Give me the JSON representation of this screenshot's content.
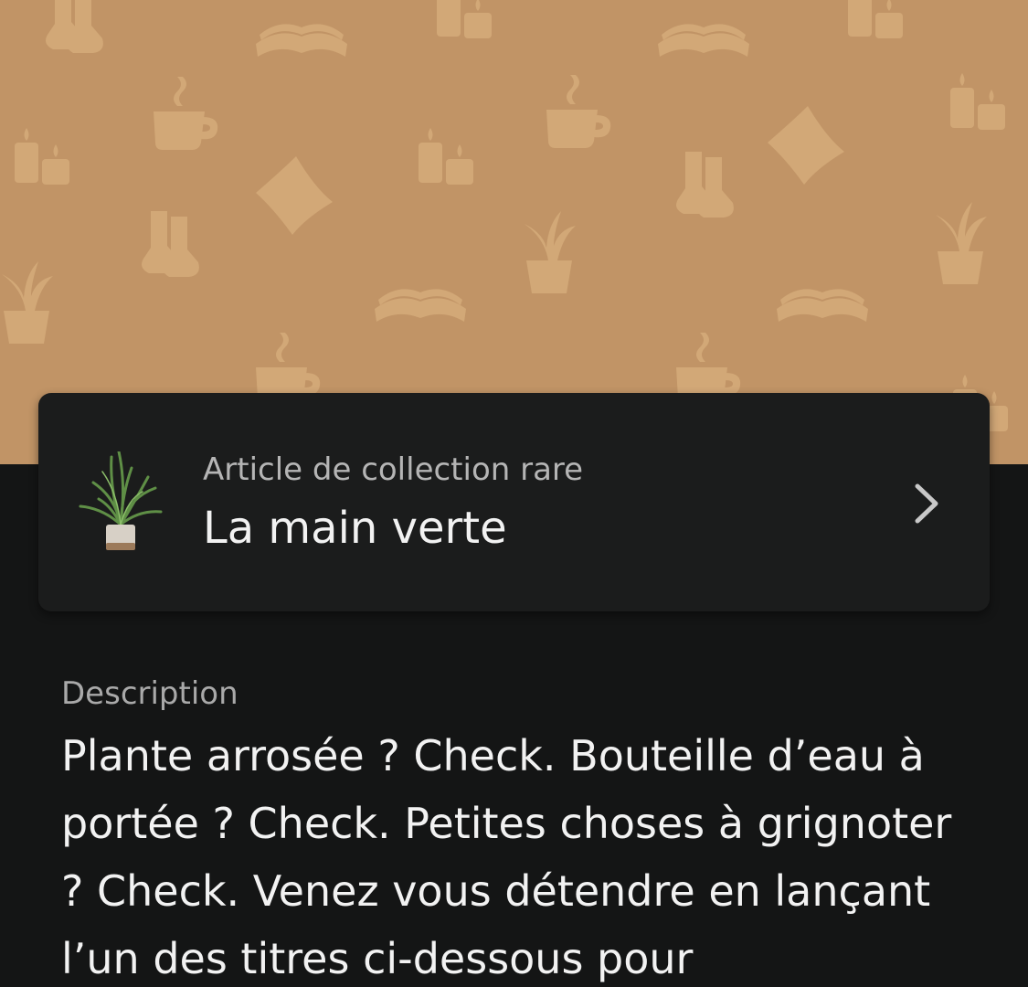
{
  "banner": {
    "background_color": "#c19466",
    "pattern_color": "#d2a877",
    "pattern_icons": [
      "sock-icon",
      "book-icon",
      "candle-icon",
      "mug-icon",
      "pillow-icon",
      "plant-icon"
    ]
  },
  "collectible": {
    "category": "Article de collection rare",
    "title": "La main verte",
    "icon": "potted-plant-icon",
    "chevron": "chevron-right-icon"
  },
  "description": {
    "label": "Description",
    "text": "Plante arrosée ? Check. Bouteille d’eau à portée ? Check. Petites choses à grignoter ? Check. Venez vous détendre en lançant l’un des titres ci-dessous pour"
  }
}
